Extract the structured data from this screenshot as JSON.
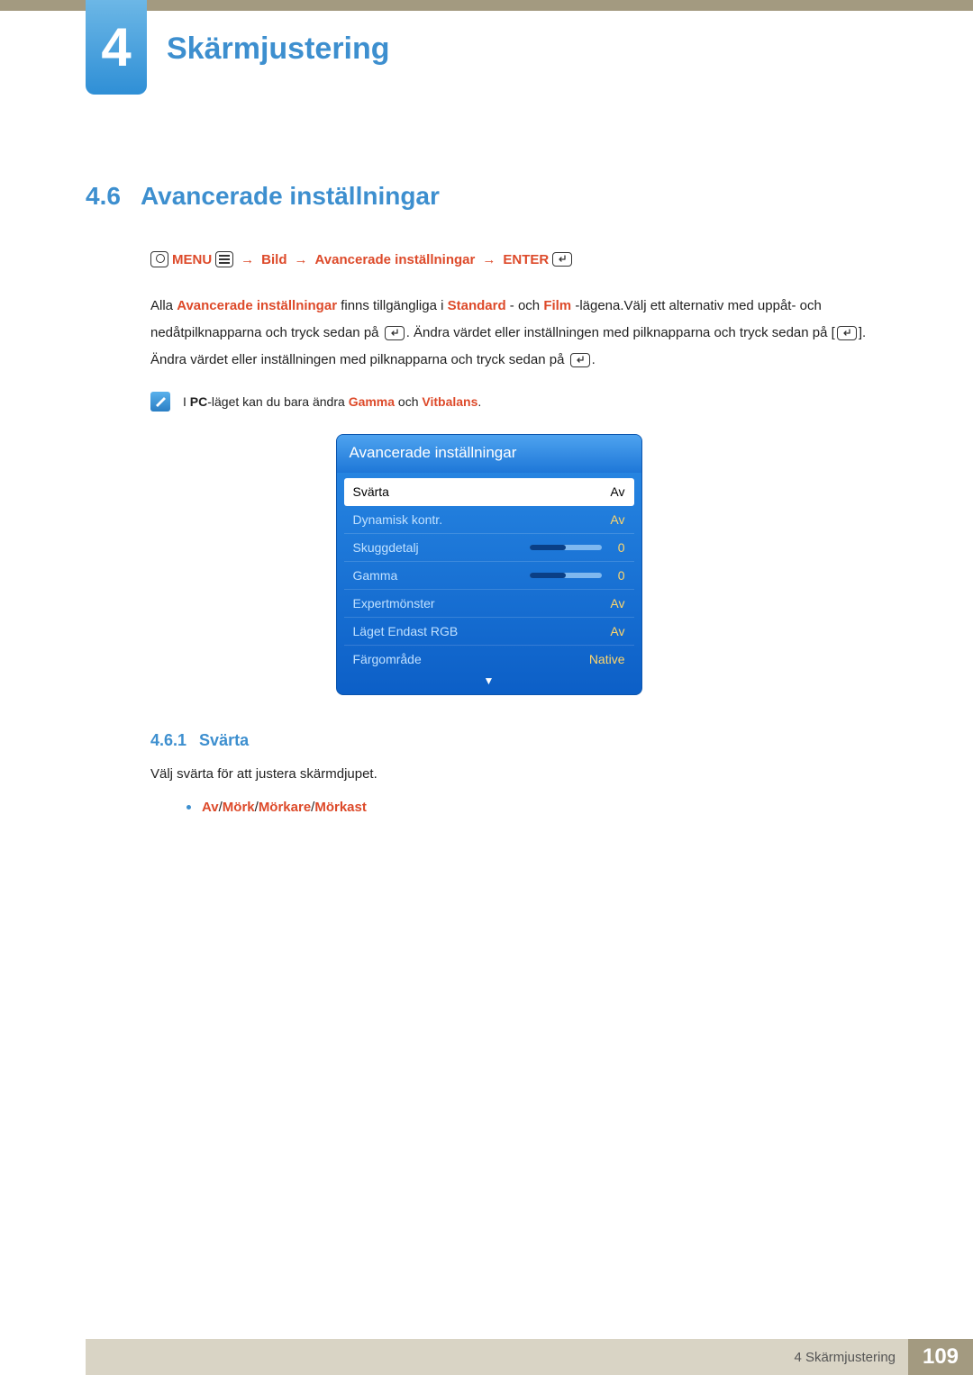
{
  "chapter": {
    "number": "4",
    "title": "Skärmjustering"
  },
  "section": {
    "number": "4.6",
    "title": "Avancerade inställningar"
  },
  "nav": {
    "menu": "MENU",
    "p1": "Bild",
    "p2": "Avancerade inställningar",
    "enter": "ENTER"
  },
  "para1": {
    "t1": "Alla ",
    "h1": "Avancerade inställningar",
    "t2": " finns tillgängliga i ",
    "h2": "Standard",
    "t3": " - och ",
    "h3": "Film",
    "t4": " -lägena.Välj ett alternativ med uppåt- och nedåtpilknapparna och tryck sedan på ",
    "t5": ". Ändra värdet eller inställningen med pilknapparna och tryck sedan på [",
    "t6": "]. Ändra värdet eller inställningen med pilknapparna och tryck sedan på ",
    "t7": "."
  },
  "note": {
    "t1": "I ",
    "h1": "PC",
    "t2": "-läget kan du bara ändra ",
    "h2": "Gamma",
    "t3": " och ",
    "h3": "Vitbalans",
    "t4": "."
  },
  "menu": {
    "title": "Avancerade inställningar",
    "items": [
      {
        "label": "Svärta",
        "value": "Av",
        "type": "text",
        "selected": true
      },
      {
        "label": "Dynamisk kontr.",
        "value": "Av",
        "type": "text"
      },
      {
        "label": "Skuggdetalj",
        "value": "0",
        "type": "slider",
        "fill": 50
      },
      {
        "label": "Gamma",
        "value": "0",
        "type": "slider",
        "fill": 50
      },
      {
        "label": "Expertmönster",
        "value": "Av",
        "type": "text"
      },
      {
        "label": "Läget Endast RGB",
        "value": "Av",
        "type": "text"
      },
      {
        "label": "Färgområde",
        "value": "Native",
        "type": "text"
      }
    ]
  },
  "subsection": {
    "number": "4.6.1",
    "title": "Svärta"
  },
  "subbody": "Välj svärta för att justera skärmdjupet.",
  "bullet": {
    "o1": "Av",
    "o2": "Mörk",
    "o3": "Mörkare",
    "o4": "Mörkast",
    "sep": "/"
  },
  "footer": {
    "label": "4 Skärmjustering",
    "page": "109"
  }
}
